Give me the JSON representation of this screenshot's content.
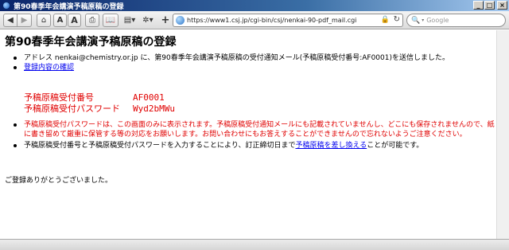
{
  "window": {
    "title": "第90春季年会講演予稿原稿の登録",
    "minimize": "_",
    "maximize": "□",
    "close": "×"
  },
  "toolbar": {
    "back": "◀",
    "forward": "▶",
    "home": "⌂",
    "font_small": "A",
    "font_large": "A",
    "print": "⎙",
    "bookmarks": "📖",
    "page_menu": "▤▾",
    "settings_menu": "✲▾",
    "add": "+",
    "url": "https://www1.csj.jp/cgi-bin/csj/nenkai-90-pdf_mail.cgi",
    "lock": "🔒",
    "reload": "↻",
    "search_placeholder": "Google",
    "search_icon": "🔍",
    "search_caret": "▾"
  },
  "page": {
    "title": "第90春季年会講演予稿原稿の登録",
    "mail_notice_prefix": "アドレス",
    "email": "nenkai@chemistry.or.jp",
    "mail_notice_suffix": "に、第90春季年会講演予稿原稿の受付通知メール(予稿原稿受付番号:AF0001)を送信しました。",
    "confirm_link": "登録内容の確認",
    "receipt_label": "予稿原稿受付番号",
    "receipt_value": "AF0001",
    "password_label": "予稿原稿受付パスワード",
    "password_value": "Wyd2bMWu",
    "note1": "予稿原稿受付パスワードは、この画面のみに表示されます。予稿原稿受付通知メールにも記載されていませんし、どこにも保存されませんので、紙に書き留めて厳重に保管する等の対応をお願いします。お問い合わせにもお答えすることができませんので忘れないようご注意ください。",
    "note2_prefix": "予稿原稿受付番号と予稿原稿受付パスワードを入力することにより、訂正締切日まで",
    "note2_link": "予稿原稿を差し換える",
    "note2_suffix": "ことが可能です。",
    "thanks": "ご登録ありがとうございました。"
  },
  "colors": {
    "alert_red": "#e00000",
    "link_blue": "#0000ee",
    "titlebar_start": "#0a246a"
  },
  "icons": {
    "app": "globe-icon",
    "back": "back-arrow-icon",
    "forward": "forward-arrow-icon",
    "home": "home-icon",
    "print": "printer-icon",
    "bookmarks": "book-icon",
    "page": "page-icon",
    "settings": "gear-icon",
    "lock": "lock-icon",
    "reload": "reload-icon",
    "search": "search-icon"
  }
}
